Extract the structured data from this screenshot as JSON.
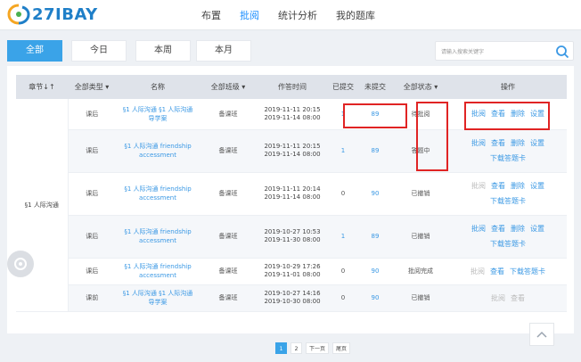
{
  "brand": {
    "name": "27IBAY"
  },
  "nav": {
    "items": [
      "布置",
      "批阅",
      "统计分析",
      "我的题库"
    ]
  },
  "filters": {
    "tabs": [
      "全部",
      "今日",
      "本周",
      "本月"
    ]
  },
  "search": {
    "placeholder": "请输入搜索关键字"
  },
  "table": {
    "headers": [
      "章节↓↑",
      "全部类型 ▾",
      "名称",
      "全部班级 ▾",
      "作答时间",
      "已提交",
      "未提交",
      "全部状态 ▾",
      "操作"
    ],
    "chapter": "§1 人际沟通",
    "rows": [
      {
        "type": "课后",
        "name": "§1 人际沟通 §1 人际沟通 导学案",
        "class": "备课班",
        "time1": "2019-11-11 20:15",
        "time2": "2019-11-14 08:00",
        "submitted": "1",
        "unsubmitted": "89",
        "status": "待批阅",
        "ops": [
          "批阅",
          "查看",
          "删除",
          "设置"
        ],
        "ops2": ""
      },
      {
        "type": "课后",
        "name": "§1 人际沟通 friendship accessment",
        "class": "备课班",
        "time1": "2019-11-11 20:15",
        "time2": "2019-11-14 08:00",
        "submitted": "1",
        "unsubmitted": "89",
        "status": "答题中",
        "ops": [
          "批阅",
          "查看",
          "删除",
          "设置"
        ],
        "ops2": "下载答题卡"
      },
      {
        "type": "课后",
        "name": "§1 人际沟通 friendship accessment",
        "class": "备课班",
        "time1": "2019-11-11 20:14",
        "time2": "2019-11-14 08:00",
        "submitted": "0",
        "unsubmitted": "90",
        "status": "已撤销",
        "ops": [
          "批阅",
          "查看",
          "删除",
          "设置"
        ],
        "ops2": "下载答题卡"
      },
      {
        "type": "课后",
        "name": "§1 人际沟通 friendship accessment",
        "class": "备课班",
        "time1": "2019-10-27 10:53",
        "time2": "2019-11-30 08:00",
        "submitted": "1",
        "unsubmitted": "89",
        "status": "已撤销",
        "ops": [
          "批阅",
          "查看",
          "删除",
          "设置"
        ],
        "ops2": "下载答题卡"
      },
      {
        "type": "课后",
        "name": "§1 人际沟通 friendship accessment",
        "class": "备课班",
        "time1": "2019-10-29 17:26",
        "time2": "2019-11-01 08:00",
        "submitted": "0",
        "unsubmitted": "90",
        "status": "批阅完成",
        "ops": [
          "批阅",
          "查看",
          "下载答题卡"
        ],
        "ops2": ""
      },
      {
        "type": "课前",
        "name": "§1 人际沟通 §1 人际沟通 导学案",
        "class": "备课班",
        "time1": "2019-10-27 14:16",
        "time2": "2019-10-30 08:00",
        "submitted": "0",
        "unsubmitted": "90",
        "status": "已撤销",
        "ops": [
          "批阅",
          "查看"
        ],
        "ops2": ""
      }
    ]
  },
  "pager": {
    "pages": [
      "1",
      "2"
    ],
    "next": "下一页",
    "last": "尾页"
  },
  "colors": {
    "accent": "#3aa3e8",
    "highlight": "#e02424",
    "link": "#3a98e4"
  }
}
